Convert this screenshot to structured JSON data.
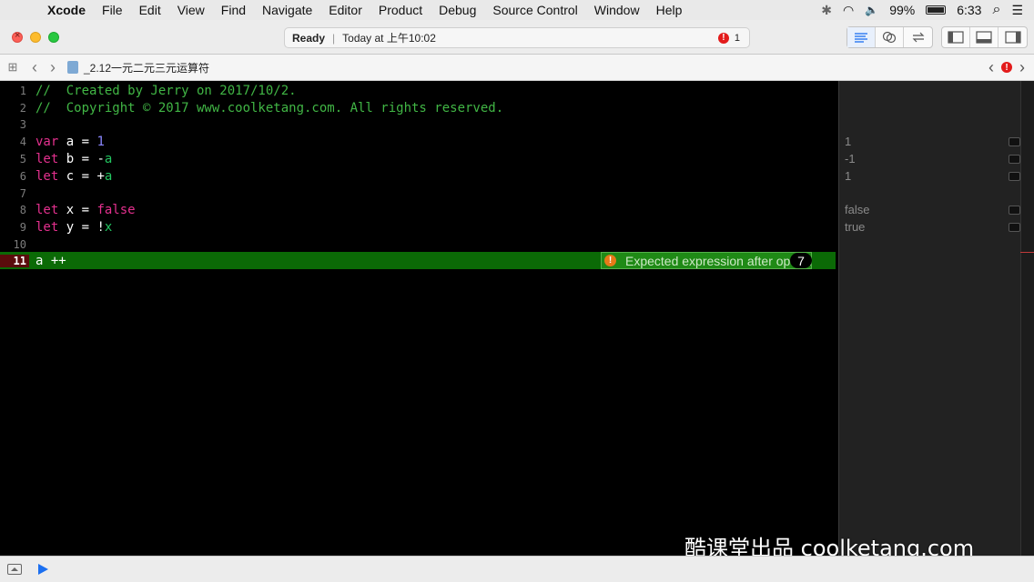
{
  "menubar": {
    "apple": "",
    "items": [
      "Xcode",
      "File",
      "Edit",
      "View",
      "Find",
      "Navigate",
      "Editor",
      "Product",
      "Debug",
      "Source Control",
      "Window",
      "Help"
    ],
    "status": {
      "bluetooth": "✱",
      "wifi": "◠",
      "volume": "🔈",
      "battery_pct": "99%",
      "time": "6:33",
      "search": "⌕",
      "list": "☰"
    }
  },
  "toolbar": {
    "status_text": "Ready",
    "separator": "|",
    "build_time": "Today at 上午10:02",
    "error_icon": "!",
    "error_count": "1"
  },
  "jumpbar": {
    "grid_icon": "⊞",
    "back": "‹",
    "forward": "›",
    "file_name": "_2.12一元二元三元运算符",
    "prev_issue": "‹",
    "issue_icon": "!",
    "next_issue": "›"
  },
  "editor": {
    "error_line_number": "11",
    "error_line_code": "a ++",
    "issue_message": "Expected expression after operator",
    "issue_icon": "!",
    "issue_count": "7"
  },
  "results": [
    "",
    "",
    "",
    "1",
    "-1",
    "1",
    "",
    "false",
    "true",
    "",
    ""
  ],
  "watermark": "酷课堂出品 coolketang.com"
}
